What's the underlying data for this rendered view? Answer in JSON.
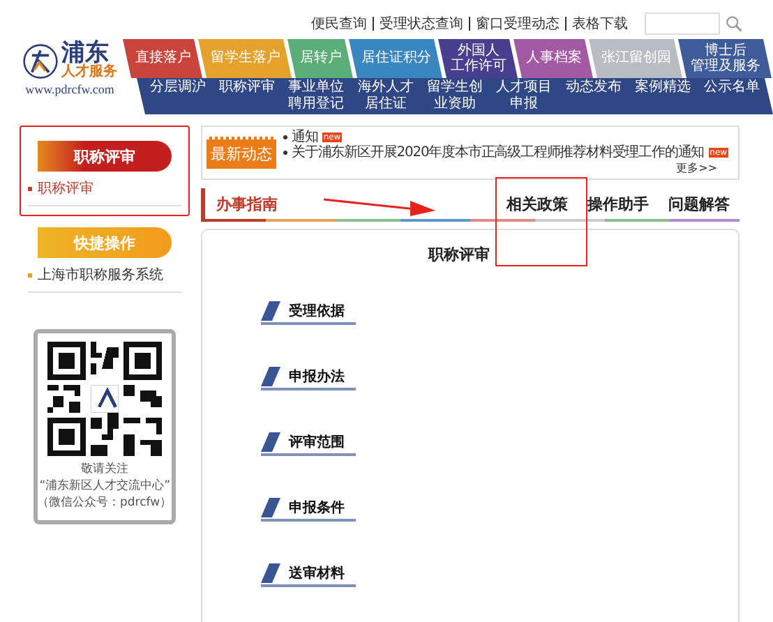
{
  "top_links": [
    "便民查询",
    "受理状态查询",
    "窗口受理动态",
    "表格下载"
  ],
  "logo": {
    "name": "浦东",
    "subtitle": "人才服务",
    "url": "www.pdrcfw.com"
  },
  "main_nav": [
    {
      "lines": [
        "直接落户"
      ],
      "color": "#c9443b"
    },
    {
      "lines": [
        "留学生落户"
      ],
      "color": "#e4a22c"
    },
    {
      "lines": [
        "居转户"
      ],
      "color": "#5bae78"
    },
    {
      "lines": [
        "居住证积分"
      ],
      "color": "#3a86c0"
    },
    {
      "lines": [
        "外国人",
        "工作许可"
      ],
      "color": "#4a3f8e"
    },
    {
      "lines": [
        "人事档案"
      ],
      "color": "#a25ba3"
    },
    {
      "lines": [
        "张江留创园"
      ],
      "color": "#b9bdc1"
    },
    {
      "lines": [
        "博士后",
        "管理及服务"
      ],
      "color": "#3d5c99"
    }
  ],
  "sub_nav": [
    "分层调沪",
    "职称评审",
    "事业单位聘用登记",
    "海外人才居住证",
    "留学生创业资助",
    "人才项目申报",
    "动态发布",
    "案例精选",
    "公示名单"
  ],
  "sidebar": {
    "section_title": "职称评审",
    "items": [
      {
        "label": "职称评审",
        "selected": true
      }
    ],
    "quick_title": "快捷操作",
    "quick_items": [
      "上海市职称服务系统"
    ],
    "qr_caption": [
      "敬请关注",
      "“浦东新区人才交流中心”",
      "（微信公众号：pdrcfw）"
    ]
  },
  "news": {
    "badge": "最新动态",
    "items": [
      {
        "title": "通知",
        "tag": "new"
      },
      {
        "title": "关于浦东新区开展2020年度本市正高级工程师推荐材料受理工作的通知",
        "tag": "new"
      }
    ],
    "more": "更多>>"
  },
  "tabs": [
    {
      "label": "办事指南",
      "selected": true
    },
    {
      "label": "相关政策",
      "selected": false,
      "highlighted": true
    },
    {
      "label": "操作助手",
      "selected": false,
      "highlighted": false
    },
    {
      "label": "问题解答",
      "selected": false,
      "highlighted": false
    }
  ],
  "content": {
    "title": "职称评审",
    "sections": [
      "受理依据",
      "申报办法",
      "评审范围",
      "申报条件",
      "送审材料"
    ]
  }
}
